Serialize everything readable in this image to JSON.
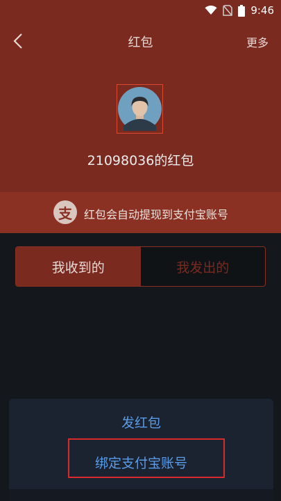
{
  "status_bar": {
    "time": "9:46",
    "icons": [
      "wifi-icon",
      "no-sim-icon",
      "battery-icon"
    ]
  },
  "nav": {
    "back_icon": "chevron-left-icon",
    "title": "红包",
    "more_label": "更多"
  },
  "profile": {
    "avatar": "default-avatar",
    "name_line": "21098036的红包"
  },
  "notice": {
    "logo_char": "支",
    "text": "红包会自动提现到支付宝账号"
  },
  "tabs": [
    {
      "label": "我收到的",
      "active": true
    },
    {
      "label": "我发出的",
      "active": false
    }
  ],
  "sheet": {
    "send_label": "发红包",
    "bind_label": "绑定支付宝账号"
  },
  "colors": {
    "header_bg": "#7a2a1f",
    "page_bg": "#14171c",
    "accent_blue": "#5a9ce8",
    "highlight_red": "#d82a2a"
  }
}
